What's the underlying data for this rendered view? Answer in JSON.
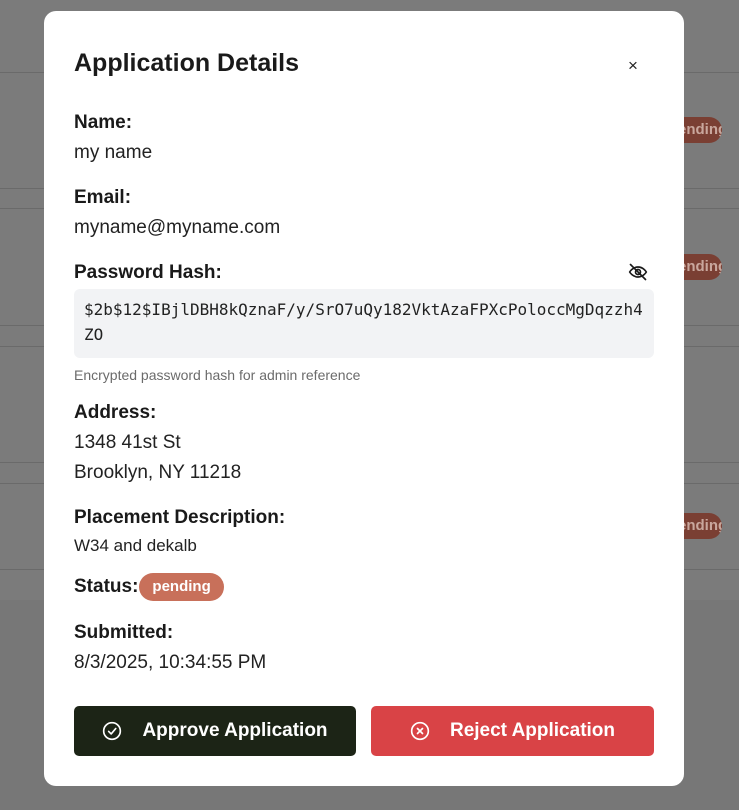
{
  "background": {
    "badge_text": "ending"
  },
  "modal": {
    "title": "Application Details",
    "close_label": "×",
    "name": {
      "label": "Name:",
      "value": "my name"
    },
    "email": {
      "label": "Email:",
      "value": "myname@myname.com"
    },
    "password": {
      "label": "Password Hash:",
      "value": "$2b$12$IBjlDBH8kQznaF/y/SrO7uQy182VktAzaFPXcPoloccMgDqzzh4ZO",
      "note": "Encrypted password hash for admin reference"
    },
    "address": {
      "label": "Address:",
      "line1": "1348 41st St",
      "line2": "Brooklyn, NY 11218"
    },
    "placement": {
      "label": "Placement Description:",
      "value": "W34 and dekalb"
    },
    "status": {
      "label": "Status:",
      "value": "pending"
    },
    "submitted": {
      "label": "Submitted:",
      "value": "8/3/2025, 10:34:55 PM"
    },
    "actions": {
      "approve_label": "Approve Application",
      "reject_label": "Reject Application"
    }
  },
  "colors": {
    "approve": "#1c2416",
    "reject": "#d94346",
    "status_badge": "#c8705a"
  },
  "icons": {
    "close": "close-icon",
    "eye": "eye-off-icon",
    "approve": "check-circle-icon",
    "reject": "x-circle-icon"
  }
}
